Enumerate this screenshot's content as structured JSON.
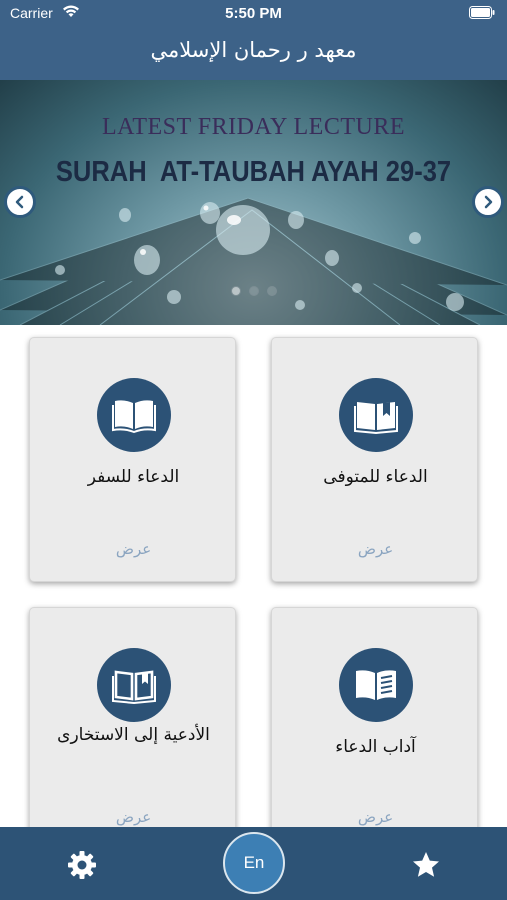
{
  "status_bar": {
    "carrier": "Carrier",
    "time": "5:50 PM"
  },
  "nav": {
    "title": "معهد ر رحمان الإسلامي"
  },
  "banner": {
    "line1": "LATEST FRIDAY LECTURE",
    "line2": "SURAH  AT-TAUBAH AYAH 29-37",
    "slide_count": 3,
    "active_slide": 1
  },
  "cards": [
    {
      "title": "الدعاء للمتوفى",
      "action": "عرض",
      "icon": "open-book-bookmark-icon"
    },
    {
      "title": "الدعاء للسفر",
      "action": "عرض",
      "icon": "open-book-icon"
    },
    {
      "title": "آداب الدعاء",
      "action": "عرض",
      "icon": "book-lines-icon"
    },
    {
      "title": "الأدعية إلى الاستخارى",
      "action": "عرض",
      "icon": "book-pages-icon"
    }
  ],
  "tab_bar": {
    "language_label": "En",
    "settings_icon": "gear-icon",
    "favorites_icon": "star-icon"
  },
  "colors": {
    "primary": "#3d6288",
    "tab_bar": "#2d5376",
    "icon_circle": "#2c5276",
    "action_text": "#8aa4c0",
    "lang_button": "#3d7fb4"
  }
}
